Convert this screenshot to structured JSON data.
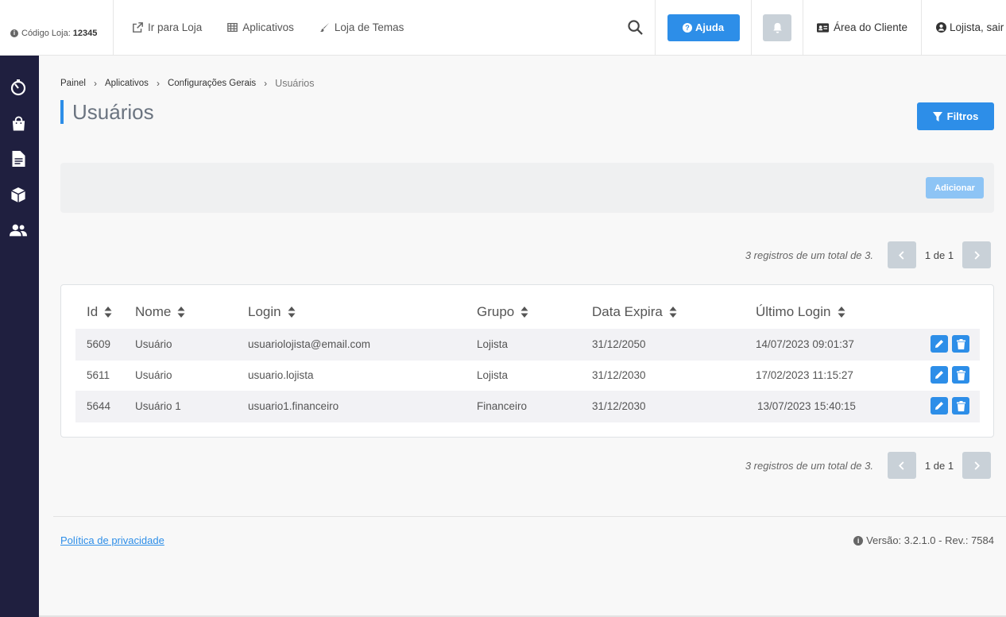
{
  "topbar": {
    "store_code_label": "Código Loja:",
    "store_code_value": "12345",
    "links": [
      {
        "label": "Ir para Loja",
        "icon": "external-link-icon"
      },
      {
        "label": "Aplicativos",
        "icon": "grid-icon"
      },
      {
        "label": "Loja de Temas",
        "icon": "brush-icon"
      }
    ],
    "help_label": "Ajuda",
    "client_area_label": "Área do Cliente",
    "user_label": "Lojista, sair"
  },
  "sidebar": {
    "icons": [
      "stopwatch-icon",
      "shopping-bag-icon",
      "document-icon",
      "box-icon",
      "users-icon"
    ]
  },
  "breadcrumb": [
    "Painel",
    "Aplicativos",
    "Configurações Gerais",
    "Usuários"
  ],
  "page": {
    "title": "Usuários",
    "filter_label": "Filtros",
    "add_label": "Adicionar"
  },
  "pagination": {
    "summary": "3 registros de um total de 3.",
    "pages": "1 de 1"
  },
  "table": {
    "columns": [
      "Id",
      "Nome",
      "Login",
      "Grupo",
      "Data Expira",
      "Último Login"
    ],
    "rows": [
      {
        "id": "5609",
        "nome": "Usuário",
        "login": "usuariolojista@email.com",
        "grupo": "Lojista",
        "expira": "31/12/2050",
        "ultimo": "14/07/2023 09:01:37"
      },
      {
        "id": "5611",
        "nome": "Usuário",
        "login": "usuario.lojista",
        "grupo": "Lojista",
        "expira": "31/12/2030",
        "ultimo": "17/02/2023 11:15:27"
      },
      {
        "id": "5644",
        "nome": "Usuário 1",
        "login": "usuario1.financeiro",
        "grupo": "Financeiro",
        "expira": "31/12/2030",
        "ultimo": "13/07/2023 15:40:15"
      }
    ]
  },
  "footer": {
    "privacy_label": "Política de privacidade",
    "version_label": "Versão: 3.2.1.0 - Rev.: 7584"
  },
  "colors": {
    "primary": "#2d8ee8",
    "sidebar": "#1f1f3f",
    "disabled": "#c9d1d8"
  }
}
